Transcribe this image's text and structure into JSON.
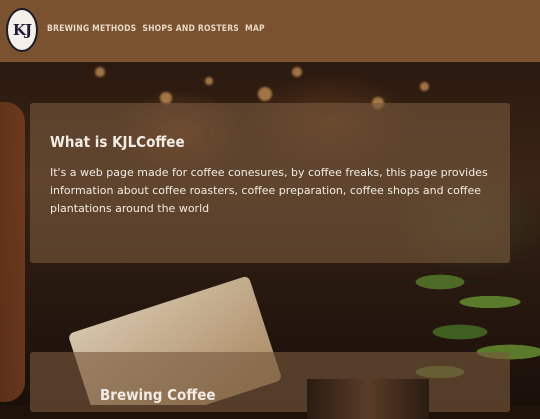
{
  "header": {
    "logo_text": "KJ",
    "nav": [
      {
        "label": "BREWING METHODS"
      },
      {
        "label": "SHOPS AND ROSTERS"
      },
      {
        "label": "MAP"
      }
    ]
  },
  "intro": {
    "title": "What is KJLCoffee",
    "body": "It's a web page made for coffee conesures, by coffee freaks, this page provides information about coffee roasters, coffee preparation, coffee shops and coffee plantations around the world"
  },
  "brewing": {
    "title": "Brewing Coffee"
  }
}
